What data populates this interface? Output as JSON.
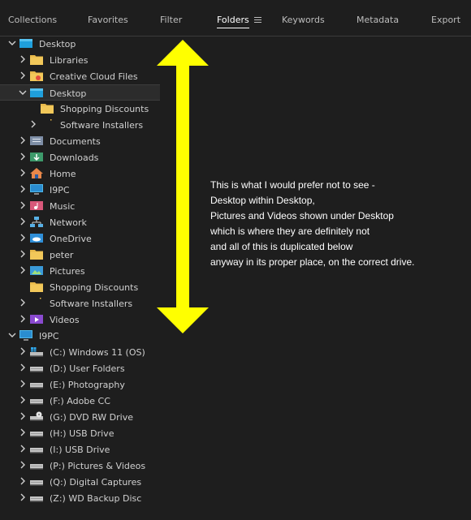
{
  "tabs": [
    {
      "label": "Collections",
      "active": false
    },
    {
      "label": "Favorites",
      "active": false
    },
    {
      "label": "Filter",
      "active": false
    },
    {
      "label": "Folders",
      "active": true
    },
    {
      "label": "Keywords",
      "active": false
    },
    {
      "label": "Metadata",
      "active": false
    },
    {
      "label": "Export",
      "active": false
    }
  ],
  "tree": [
    {
      "label": "Desktop",
      "level": 0,
      "expanded": true,
      "icon": "desktop-folder-icon",
      "selected": false
    },
    {
      "label": "Libraries",
      "level": 1,
      "expanded": false,
      "icon": "folder-icon",
      "selected": false
    },
    {
      "label": "Creative Cloud Files",
      "level": 1,
      "expanded": false,
      "icon": "creative-cloud-folder-icon",
      "selected": false
    },
    {
      "label": "Desktop",
      "level": 1,
      "expanded": true,
      "icon": "desktop-folder-icon",
      "selected": true
    },
    {
      "label": "Shopping Discounts",
      "level": 2,
      "expanded": null,
      "icon": "folder-icon",
      "selected": false
    },
    {
      "label": "Software Installers",
      "level": 2,
      "expanded": false,
      "icon": "none",
      "selected": false
    },
    {
      "label": "Documents",
      "level": 1,
      "expanded": false,
      "icon": "documents-folder-icon",
      "selected": false
    },
    {
      "label": "Downloads",
      "level": 1,
      "expanded": false,
      "icon": "downloads-folder-icon",
      "selected": false
    },
    {
      "label": "Home",
      "level": 1,
      "expanded": false,
      "icon": "home-icon",
      "selected": false
    },
    {
      "label": "I9PC",
      "level": 1,
      "expanded": false,
      "icon": "computer-icon",
      "selected": false
    },
    {
      "label": "Music",
      "level": 1,
      "expanded": false,
      "icon": "music-folder-icon",
      "selected": false
    },
    {
      "label": "Network",
      "level": 1,
      "expanded": false,
      "icon": "network-icon",
      "selected": false
    },
    {
      "label": "OneDrive",
      "level": 1,
      "expanded": false,
      "icon": "onedrive-icon",
      "selected": false
    },
    {
      "label": "peter",
      "level": 1,
      "expanded": false,
      "icon": "folder-icon",
      "selected": false
    },
    {
      "label": "Pictures",
      "level": 1,
      "expanded": false,
      "icon": "pictures-folder-icon",
      "selected": false
    },
    {
      "label": "Shopping Discounts",
      "level": 1,
      "expanded": null,
      "icon": "folder-icon",
      "selected": false
    },
    {
      "label": "Software Installers",
      "level": 1,
      "expanded": false,
      "icon": "none",
      "selected": false
    },
    {
      "label": "Videos",
      "level": 1,
      "expanded": false,
      "icon": "videos-folder-icon",
      "selected": false
    },
    {
      "label": "I9PC",
      "level": 0,
      "expanded": true,
      "icon": "computer-icon",
      "selected": false
    },
    {
      "label": "(C:) Windows 11 (OS)",
      "level": 1,
      "expanded": false,
      "icon": "os-drive-icon",
      "selected": false
    },
    {
      "label": "(D:) User Folders",
      "level": 1,
      "expanded": false,
      "icon": "drive-icon",
      "selected": false
    },
    {
      "label": "(E:) Photography",
      "level": 1,
      "expanded": false,
      "icon": "drive-icon",
      "selected": false
    },
    {
      "label": "(F:) Adobe CC",
      "level": 1,
      "expanded": false,
      "icon": "drive-icon",
      "selected": false
    },
    {
      "label": "(G:) DVD RW Drive",
      "level": 1,
      "expanded": false,
      "icon": "dvd-drive-icon",
      "selected": false
    },
    {
      "label": "(H:) USB Drive",
      "level": 1,
      "expanded": false,
      "icon": "drive-icon",
      "selected": false
    },
    {
      "label": "(I:) USB Drive",
      "level": 1,
      "expanded": false,
      "icon": "drive-icon",
      "selected": false
    },
    {
      "label": "(P:) Pictures & Videos",
      "level": 1,
      "expanded": false,
      "icon": "drive-icon",
      "selected": false
    },
    {
      "label": "(Q:) Digital Captures",
      "level": 1,
      "expanded": false,
      "icon": "drive-icon",
      "selected": false
    },
    {
      "label": "(Z:) WD Backup Disc",
      "level": 1,
      "expanded": false,
      "icon": "drive-icon",
      "selected": false
    }
  ],
  "annotation": {
    "lines": [
      "This is what I would prefer not to see -",
      "Desktop within Desktop,",
      "Pictures and Videos shown under Desktop",
      "which is where they are definitely not",
      "and all of this is duplicated below",
      "anyway in its proper place, on the correct drive."
    ],
    "arrow_color": "#ffff00"
  },
  "colors": {
    "background": "#1e1e1e",
    "text": "#d0d0d0",
    "folder": "#e8b94a",
    "desktop_folder": "#1f9fdc",
    "selection": "#2c2c2c"
  }
}
